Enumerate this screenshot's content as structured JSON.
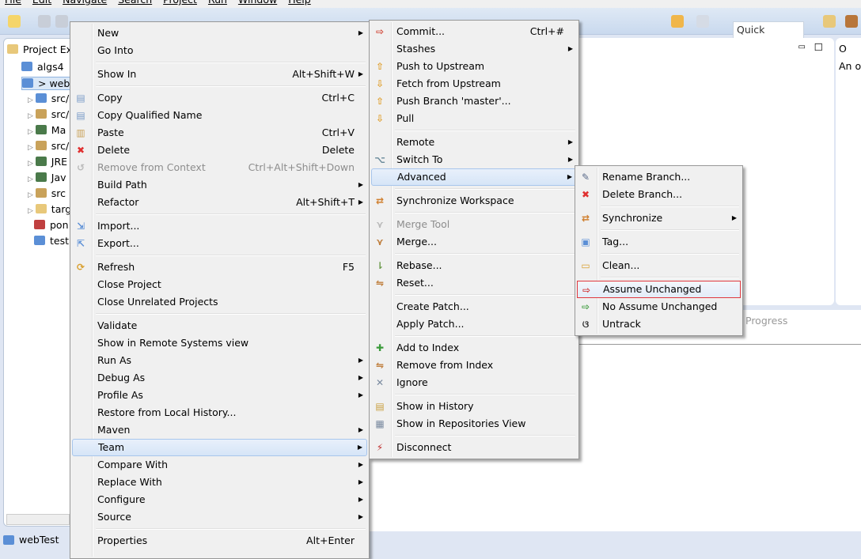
{
  "menubar": [
    "File",
    "Edit",
    "Navigate",
    "Search",
    "Project",
    "Run",
    "Window",
    "Help"
  ],
  "quick_access": "Quick Access",
  "explorer": {
    "title": "Project Exp",
    "items": [
      "algs4",
      "> webT",
      "src/",
      "src/",
      "Ma",
      "src/",
      "JRE",
      "Jav",
      "src",
      "targ",
      "pon",
      "test"
    ]
  },
  "outline": {
    "title": "O",
    "text": "An o"
  },
  "progress_text": "Progress",
  "status": {
    "project": "webTest"
  },
  "menu_main": [
    [
      {
        "label": "New",
        "submenu": true
      },
      {
        "label": "Go Into"
      }
    ],
    [
      {
        "label": "Show In",
        "shortcut": "Alt+Shift+W",
        "submenu": true
      }
    ],
    [
      {
        "label": "Copy",
        "shortcut": "Ctrl+C",
        "icon": "copy-icon"
      },
      {
        "label": "Copy Qualified Name",
        "icon": "copy-qualified-icon"
      },
      {
        "label": "Paste",
        "shortcut": "Ctrl+V",
        "icon": "paste-icon"
      },
      {
        "label": "Delete",
        "shortcut": "Delete",
        "icon": "delete-icon"
      },
      {
        "label": "Remove from Context",
        "shortcut": "Ctrl+Alt+Shift+Down",
        "disabled": true,
        "icon": "remove-context-icon"
      },
      {
        "label": "Build Path",
        "submenu": true
      },
      {
        "label": "Refactor",
        "shortcut": "Alt+Shift+T",
        "submenu": true
      }
    ],
    [
      {
        "label": "Import...",
        "icon": "import-icon"
      },
      {
        "label": "Export...",
        "icon": "export-icon"
      }
    ],
    [
      {
        "label": "Refresh",
        "shortcut": "F5",
        "icon": "refresh-icon"
      },
      {
        "label": "Close Project"
      },
      {
        "label": "Close Unrelated Projects"
      }
    ],
    [
      {
        "label": "Validate"
      },
      {
        "label": "Show in Remote Systems view"
      },
      {
        "label": "Run As",
        "submenu": true
      },
      {
        "label": "Debug As",
        "submenu": true
      },
      {
        "label": "Profile As",
        "submenu": true
      },
      {
        "label": "Restore from Local History..."
      },
      {
        "label": "Maven",
        "submenu": true
      },
      {
        "label": "Team",
        "submenu": true,
        "highlighted": true
      },
      {
        "label": "Compare With",
        "submenu": true
      },
      {
        "label": "Replace With",
        "submenu": true
      },
      {
        "label": "Configure",
        "submenu": true
      },
      {
        "label": "Source",
        "submenu": true
      }
    ],
    [
      {
        "label": "Properties",
        "shortcut": "Alt+Enter"
      }
    ]
  ],
  "menu_team": [
    [
      {
        "label": "Commit...",
        "shortcut": "Ctrl+#",
        "icon": "commit-icon"
      },
      {
        "label": "Stashes",
        "submenu": true
      },
      {
        "label": "Push to Upstream",
        "icon": "push-icon"
      },
      {
        "label": "Fetch from Upstream",
        "icon": "fetch-icon"
      },
      {
        "label": "Push Branch 'master'...",
        "icon": "push-branch-icon"
      },
      {
        "label": "Pull",
        "icon": "pull-icon"
      }
    ],
    [
      {
        "label": "Remote",
        "submenu": true
      },
      {
        "label": "Switch To",
        "submenu": true,
        "icon": "switch-icon"
      },
      {
        "label": "Advanced",
        "submenu": true,
        "highlighted": true
      }
    ],
    [
      {
        "label": "Synchronize Workspace",
        "icon": "synchronize-icon"
      }
    ],
    [
      {
        "label": "Merge Tool",
        "disabled": true,
        "icon": "merge-tool-icon"
      },
      {
        "label": "Merge...",
        "icon": "merge-icon"
      }
    ],
    [
      {
        "label": "Rebase...",
        "icon": "rebase-icon"
      },
      {
        "label": "Reset...",
        "icon": "reset-icon"
      }
    ],
    [
      {
        "label": "Create Patch..."
      },
      {
        "label": "Apply Patch..."
      }
    ],
    [
      {
        "label": "Add to Index",
        "icon": "add-icon"
      },
      {
        "label": "Remove from Index",
        "icon": "remove-index-icon"
      },
      {
        "label": "Ignore",
        "icon": "ignore-icon"
      }
    ],
    [
      {
        "label": "Show in History",
        "icon": "history-icon"
      },
      {
        "label": "Show in Repositories View",
        "icon": "git-repo-icon"
      }
    ],
    [
      {
        "label": "Disconnect",
        "icon": "disconnect-icon"
      }
    ]
  ],
  "menu_advanced": [
    [
      {
        "label": "Rename Branch...",
        "icon": "rename-icon"
      },
      {
        "label": "Delete Branch...",
        "icon": "delete-icon"
      }
    ],
    [
      {
        "label": "Synchronize",
        "submenu": true,
        "icon": "synchronize-icon"
      }
    ],
    [
      {
        "label": "Tag...",
        "icon": "tag-icon"
      }
    ],
    [
      {
        "label": "Clean...",
        "icon": "clean-icon"
      }
    ],
    [
      {
        "label": "Assume Unchanged",
        "icon": "assume-unchanged-icon",
        "outlined": true
      },
      {
        "label": "No Assume Unchanged",
        "icon": "no-assume-unchanged-icon"
      },
      {
        "label": "Untrack",
        "icon": "untrack-icon"
      }
    ]
  ],
  "colors": {
    "highlight": "#d6e5f7",
    "outline_red": "#e0383e",
    "toolbar": "#c9d9ee"
  }
}
